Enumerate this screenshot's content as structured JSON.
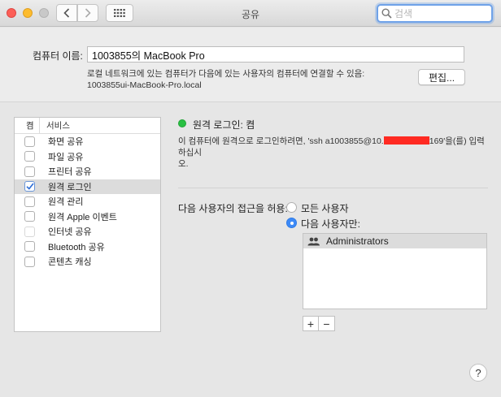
{
  "window": {
    "title": "공유"
  },
  "search": {
    "placeholder": "검색"
  },
  "computer_name": {
    "label": "컴퓨터 이름:",
    "value": "1003855의 MacBook Pro",
    "description_line1": "로컬 네트워크에 있는 컴퓨터가 다음에 있는 사용자의 컴퓨터에 연결할 수 있음:",
    "description_line2": "1003855ui-MacBook-Pro.local",
    "edit_label": "편집..."
  },
  "services": {
    "col_on": "켬",
    "col_service": "서비스",
    "items": [
      {
        "label": "화면 공유",
        "checked": false
      },
      {
        "label": "파일 공유",
        "checked": false
      },
      {
        "label": "프린터 공유",
        "checked": false
      },
      {
        "label": "원격 로그인",
        "checked": true,
        "selected": true
      },
      {
        "label": "원격 관리",
        "checked": false
      },
      {
        "label": "원격 Apple 이벤트",
        "checked": false
      },
      {
        "label": "인터넷 공유",
        "checked": false,
        "disabled": true
      },
      {
        "label": "Bluetooth 공유",
        "checked": false
      },
      {
        "label": "콘텐츠 캐싱",
        "checked": false
      }
    ]
  },
  "detail": {
    "status": "원격 로그인: 켬",
    "status_color": "#29c043",
    "desc_part1": "이 컴퓨터에 원격으로 로그인하려면, 'ssh a1003855@10.",
    "desc_part2": "169'을(를) 입력하십시",
    "desc_part3": "오.",
    "access_label": "다음 사용자의 접근을 허용:",
    "option_all": "모든 사용자",
    "option_only": "다음 사용자만:",
    "users": [
      "Administrators"
    ],
    "add_label": "+",
    "remove_label": "−"
  },
  "help_label": "?"
}
